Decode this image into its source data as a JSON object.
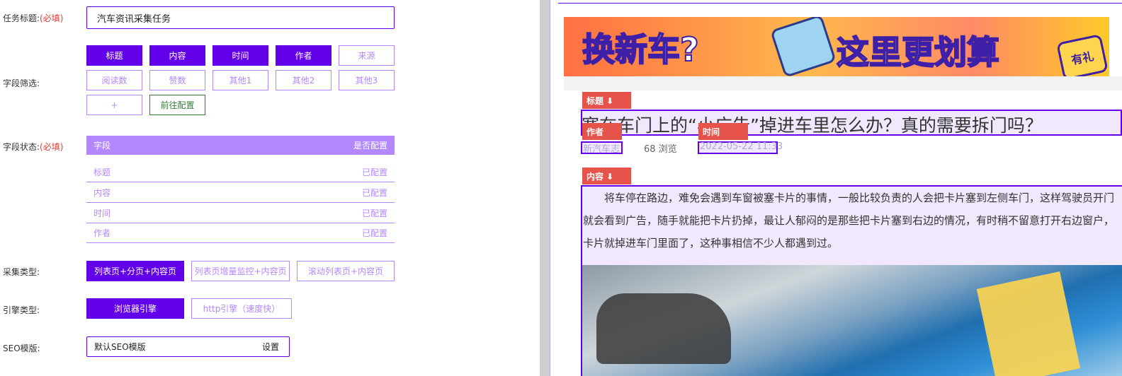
{
  "form": {
    "task_title_label": "任务标题:",
    "required_mark": "(必填)",
    "task_title_value": "汽车资讯采集任务",
    "field_filter_label": "字段筛选:",
    "field_chips": [
      {
        "label": "标题",
        "active": true
      },
      {
        "label": "内容",
        "active": true
      },
      {
        "label": "时间",
        "active": true
      },
      {
        "label": "作者",
        "active": true
      },
      {
        "label": "来源",
        "active": false
      },
      {
        "label": "阅读数",
        "active": false
      },
      {
        "label": "赞数",
        "active": false
      },
      {
        "label": "其他1",
        "active": false
      },
      {
        "label": "其他2",
        "active": false
      },
      {
        "label": "其他3",
        "active": false
      }
    ],
    "add_chip": "+",
    "goto_config": "前往配置",
    "field_status_label": "字段状态:",
    "table_header": {
      "col1": "字段",
      "col2": "是否配置"
    },
    "table_rows": [
      {
        "field": "标题",
        "status": "已配置"
      },
      {
        "field": "内容",
        "status": "已配置"
      },
      {
        "field": "时间",
        "status": "已配置"
      },
      {
        "field": "作者",
        "status": "已配置"
      }
    ],
    "collect_type_label": "采集类型:",
    "collect_types": [
      {
        "label": "列表页+分页+内容页",
        "active": true
      },
      {
        "label": "列表页增量监控+内容页",
        "active": false
      },
      {
        "label": "滚动列表页+内容页",
        "active": false
      }
    ],
    "engine_type_label": "引擎类型:",
    "engine_types": [
      {
        "label": "浏览器引擎",
        "active": true
      },
      {
        "label": "http引擎（速度快）",
        "active": false
      }
    ],
    "seo_label": "SEO模版:",
    "seo_value": "默认SEO模版",
    "seo_settings": "设置"
  },
  "preview": {
    "banner_left": "换新车?",
    "banner_right": "这里更划算",
    "banner_badge": "有礼",
    "tags": {
      "title": "标题 ⬇",
      "author": "作者",
      "time": "时间",
      "content": "内容 ⬇"
    },
    "article_title": "塞在车门上的“小广告”掉进车里怎么办？真的需要拆门吗？",
    "author": "新汽车志",
    "views": "68 浏览",
    "time": "2022-05-22 11:33",
    "body": "将车停在路边，难免会遇到车窗被塞卡片的事情，一般比较负责的人会把卡片塞到左侧车门，这样驾驶员开门就会看到广告，随手就能把卡片扔掉，最让人郁闷的是那些把卡片塞到右边的情况，有时稍不留意打开右边窗户，卡片就掉进车门里面了，这种事相信不少人都遇到过。"
  },
  "colors": {
    "accent": "#6200ea",
    "light": "#b388ff",
    "tag": "#e5534b",
    "required": "#e53935"
  }
}
